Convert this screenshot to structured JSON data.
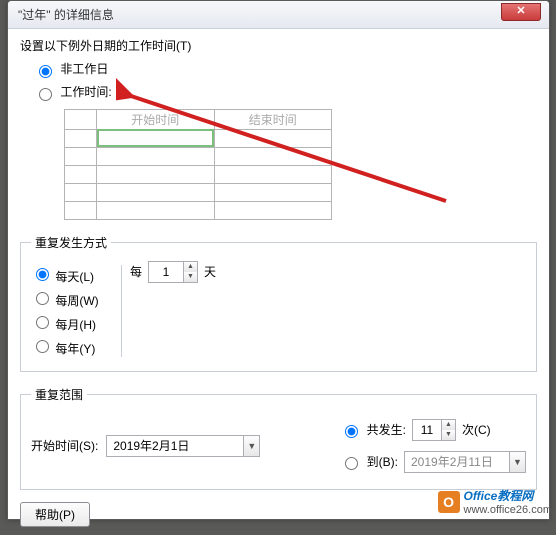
{
  "title": "\"过年\" 的详细信息",
  "instruction": "设置以下例外日期的工作时间(T)",
  "radio_nonworking": "非工作日",
  "radio_working": "工作时间:",
  "table": {
    "col1": "开始时间",
    "col2": "结束时间"
  },
  "recurrence": {
    "legend": "重复发生方式",
    "daily": "每天(L)",
    "weekly": "每周(W)",
    "monthly": "每月(H)",
    "yearly": "每年(Y)",
    "every_label": "每",
    "every_value": "1",
    "days_label": "天"
  },
  "range": {
    "legend": "重复范围",
    "start_label": "开始时间(S):",
    "start_value": "2019年2月1日",
    "occur_label": "共发生:",
    "occur_value": "11",
    "occur_suffix": "次(C)",
    "until_label": "到(B):",
    "until_value": "2019年2月11日"
  },
  "help_btn": "帮助(P)",
  "watermark": {
    "text": "Office教程网",
    "url": "www.office26.com"
  }
}
